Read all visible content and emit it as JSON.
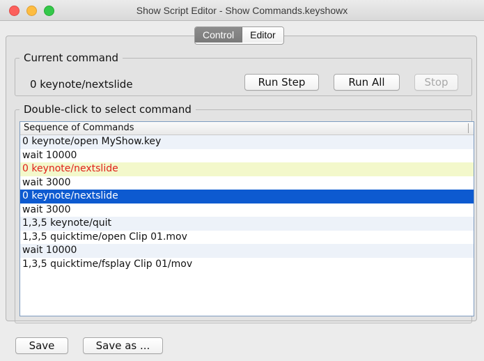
{
  "window": {
    "title": "Show Script Editor - Show Commands.keyshowx"
  },
  "tabs": [
    {
      "label": "Control",
      "active": true
    },
    {
      "label": "Editor",
      "active": false
    }
  ],
  "current_command": {
    "legend": "Current command",
    "value": "0 keynote/nextslide",
    "run_step_label": "Run Step",
    "run_all_label": "Run All",
    "stop_label": "Stop",
    "stop_enabled": false
  },
  "command_list": {
    "legend": "Double-click to select command",
    "header": "Sequence of Commands",
    "rows": [
      {
        "text": "0 keynote/open MyShow.key",
        "state": "alt"
      },
      {
        "text": "wait 10000",
        "state": "normal"
      },
      {
        "text": "0 keynote/nextslide",
        "state": "running"
      },
      {
        "text": "wait 3000",
        "state": "normal"
      },
      {
        "text": "0 keynote/nextslide",
        "state": "selected"
      },
      {
        "text": "wait 3000",
        "state": "normal"
      },
      {
        "text": "1,3,5 keynote/quit",
        "state": "alt"
      },
      {
        "text": "1,3,5 quicktime/open Clip 01.mov",
        "state": "normal"
      },
      {
        "text": "wait 10000",
        "state": "alt"
      },
      {
        "text": "1,3,5 quicktime/fsplay Clip 01/mov",
        "state": "normal"
      }
    ]
  },
  "footer": {
    "save_label": "Save",
    "save_as_label": "Save as ..."
  },
  "colors": {
    "selected_row": "#0d5ad0",
    "running_row_bg": "#f3f8cb",
    "running_row_text": "#e0201a"
  }
}
